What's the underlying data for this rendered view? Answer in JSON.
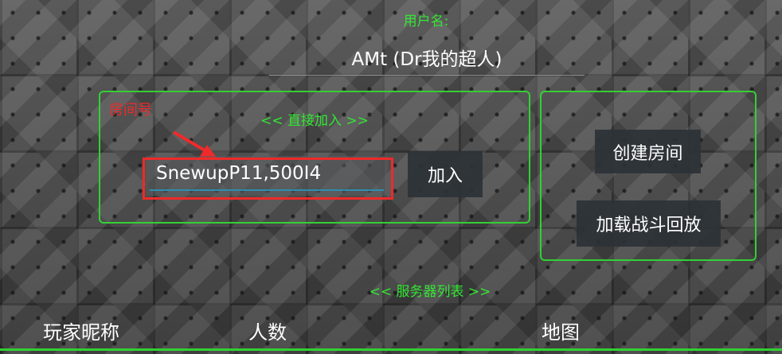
{
  "user": {
    "label": "用户名:",
    "name": "AMt (Dr我的超人)"
  },
  "join_panel": {
    "title": "<< 直接加入 >>",
    "room_id_annotation": "房间号",
    "room_id_value": "SnewupP11,500I4",
    "join_button": "加入"
  },
  "side_panel": {
    "create_room_button": "创建房间",
    "load_replay_button": "加载战斗回放"
  },
  "server_list": {
    "title": "<< 服务器列表 >>",
    "columns": [
      "玩家昵称",
      "人数",
      "地图"
    ]
  },
  "colors": {
    "accent_green": "#33d033",
    "annotation_red": "#ee2a2a",
    "input_underline": "#2a8fb0"
  }
}
